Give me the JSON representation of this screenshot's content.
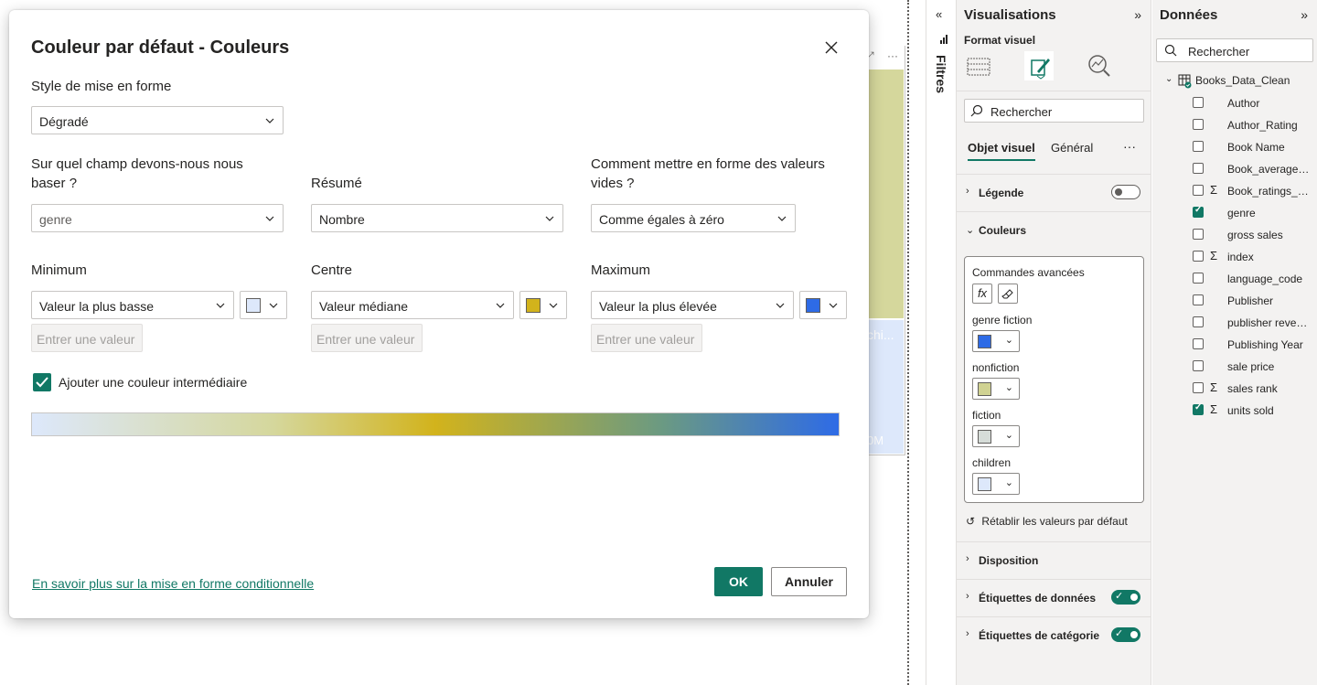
{
  "canvas": {
    "visual_more": "···",
    "visual_label_1": "chi...",
    "visual_label_2": "0M"
  },
  "filters": {
    "label": "Filtres"
  },
  "viz": {
    "title": "Visualisations",
    "subtitle": "Format visuel",
    "search_placeholder": "Rechercher",
    "tabs": [
      "Objet visuel",
      "Général"
    ],
    "more": "···",
    "sections": {
      "legend": "Légende",
      "colors": "Couleurs",
      "layout": "Disposition",
      "data_labels": "Étiquettes de données",
      "category_labels": "Étiquettes de catégorie"
    },
    "toggles": {
      "legend": false,
      "data_labels": true,
      "category_labels": true
    },
    "advanced_label": "Commandes avancées",
    "fx_label": "fx",
    "color_items": [
      {
        "label": "genre fiction",
        "color": "#2e6be6"
      },
      {
        "label": "nonfiction",
        "color": "#d0d292"
      },
      {
        "label": "fiction",
        "color": "#d6dcd8"
      },
      {
        "label": "children",
        "color": "#dde8fb"
      }
    ],
    "reset": "Rétablir les valeurs par défaut"
  },
  "data_pane": {
    "title": "Données",
    "search_placeholder": "Rechercher",
    "table_name": "Books_Data_Clean",
    "fields": [
      {
        "name": "Author",
        "sigma": false,
        "checked": false
      },
      {
        "name": "Author_Rating",
        "sigma": false,
        "checked": false
      },
      {
        "name": "Book Name",
        "sigma": false,
        "checked": false
      },
      {
        "name": "Book_average_r...",
        "sigma": false,
        "checked": false
      },
      {
        "name": "Book_ratings_c...",
        "sigma": true,
        "checked": false
      },
      {
        "name": "genre",
        "sigma": false,
        "checked": true
      },
      {
        "name": "gross sales",
        "sigma": false,
        "checked": false
      },
      {
        "name": "index",
        "sigma": true,
        "checked": false
      },
      {
        "name": "language_code",
        "sigma": false,
        "checked": false
      },
      {
        "name": "Publisher",
        "sigma": false,
        "checked": false
      },
      {
        "name": "publisher reven...",
        "sigma": false,
        "checked": false
      },
      {
        "name": "Publishing Year",
        "sigma": false,
        "checked": false
      },
      {
        "name": "sale price",
        "sigma": false,
        "checked": false
      },
      {
        "name": "sales rank",
        "sigma": true,
        "checked": false
      },
      {
        "name": "units sold",
        "sigma": true,
        "checked": true
      }
    ]
  },
  "dialog": {
    "title": "Couleur par défaut - Couleurs",
    "format_style_label": "Style de mise en forme",
    "format_style_value": "Dégradé",
    "field_label": "Sur quel champ devons-nous nous baser ?",
    "field_value": "genre",
    "summary_label": "Résumé",
    "summary_value": "Nombre",
    "empty_label": "Comment mettre en forme des valeurs vides ?",
    "empty_value": "Comme égales à zéro",
    "min_label": "Minimum",
    "min_value": "Valeur la plus basse",
    "min_color": "#dde8fb",
    "center_label": "Centre",
    "center_value": "Valeur médiane",
    "center_color": "#d2b31c",
    "max_label": "Maximum",
    "max_value": "Valeur la plus élevée",
    "max_color": "#2e6be6",
    "enter_value_placeholder": "Entrer une valeur",
    "add_middle_color_label": "Ajouter une couleur intermédiaire",
    "add_middle_color_checked": true,
    "learn_more": "En savoir plus sur la mise en forme conditionnelle",
    "ok": "OK",
    "cancel": "Annuler"
  }
}
